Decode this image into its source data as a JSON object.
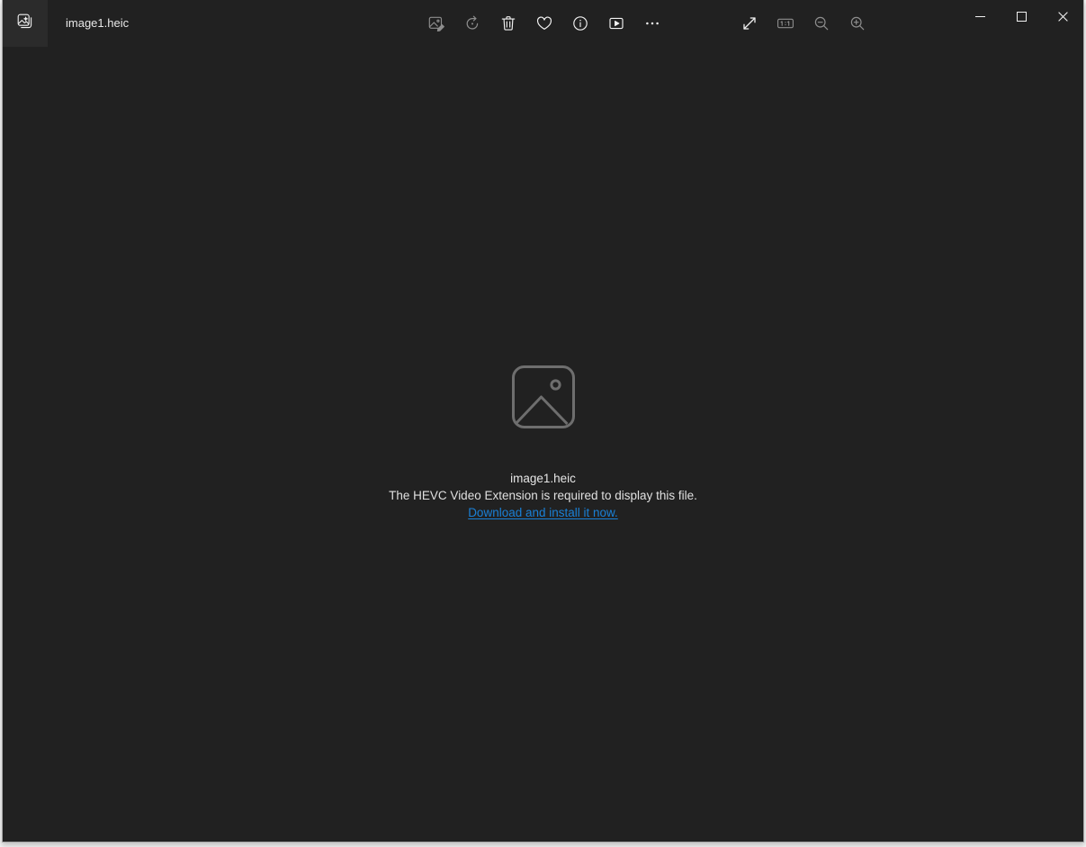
{
  "window": {
    "title": "image1.heic",
    "background_color": "#212121",
    "border_color": "#a6a6a6"
  },
  "titlebar": {
    "gallery_button": {
      "icon": "collection-images-icon",
      "tooltip": "Gallery"
    },
    "file_name": "image1.heic",
    "center_tools": [
      {
        "name": "edit-image-button",
        "icon": "image-edit-icon",
        "label": "Edit image",
        "enabled": false
      },
      {
        "name": "rotate-button",
        "icon": "rotate-icon",
        "label": "Rotate",
        "enabled": false
      },
      {
        "name": "delete-button",
        "icon": "trash-icon",
        "label": "Delete",
        "enabled": true
      },
      {
        "name": "favorite-button",
        "icon": "heart-icon",
        "label": "Add to favorites",
        "enabled": true
      },
      {
        "name": "info-button",
        "icon": "info-circle-icon",
        "label": "File info",
        "enabled": true
      },
      {
        "name": "slideshow-button",
        "icon": "play-box-icon",
        "label": "Start slideshow",
        "enabled": true
      },
      {
        "name": "more-options-button",
        "icon": "ellipsis-icon",
        "label": "See more",
        "enabled": true
      }
    ],
    "right_tools": [
      {
        "name": "fit-to-window-button",
        "icon": "diagonal-arrows-icon",
        "label": "Fit to window",
        "enabled": true
      },
      {
        "name": "actual-size-button",
        "icon": "one-to-one-icon",
        "label": "1:1",
        "enabled": false
      },
      {
        "name": "zoom-out-button",
        "icon": "zoom-out-icon",
        "label": "Zoom out",
        "enabled": false
      },
      {
        "name": "zoom-in-button",
        "icon": "zoom-in-icon",
        "label": "Zoom in",
        "enabled": false
      }
    ],
    "window_controls": [
      {
        "name": "minimize-button",
        "icon": "minimize-icon",
        "label": "Minimize"
      },
      {
        "name": "maximize-button",
        "icon": "maximize-icon",
        "label": "Maximize"
      },
      {
        "name": "close-button",
        "icon": "close-icon",
        "label": "Close"
      }
    ]
  },
  "content": {
    "placeholder_icon": "image-placeholder-icon",
    "filename": "image1.heic",
    "description": "The HEVC Video Extension is required to display this file.",
    "link_text": "Download and install it now.",
    "link_color": "#1a80d6",
    "icon_color": "#6e6e6e"
  }
}
